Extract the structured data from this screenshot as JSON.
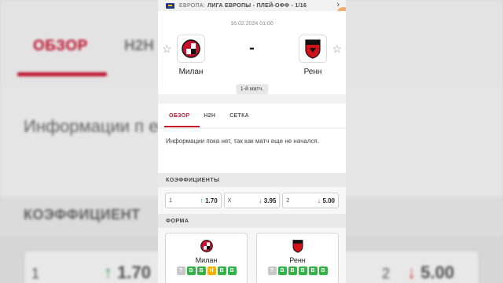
{
  "background": {
    "tab_overview": "ОБЗОР",
    "tab_h2h": "H2H",
    "info_text": "Информации п   еще не начался.",
    "section_odds": "КОЭФФИЦИЕНТ",
    "odd1_label": "1",
    "odd1_value": "1.70",
    "odd2_label": "2",
    "odd2_value": "5.00"
  },
  "header": {
    "region": "ЕВРОПА:",
    "competition": "ЛИГА ЕВРОПЫ - ПЛЕЙ-ОФФ - 1/16"
  },
  "match": {
    "date": "16.02.2024 01:00",
    "score": "-",
    "home": "Милан",
    "away": "Ренн",
    "leg": "1-й матч."
  },
  "tabs": [
    "ОБЗОР",
    "H2H",
    "СЕТКА"
  ],
  "info": "Информации пока нет, так как матч еще не начался.",
  "odds": {
    "title": "КОЭФФИЦИЕНТЫ",
    "items": [
      {
        "label": "1",
        "value": "1.70",
        "trend": "up"
      },
      {
        "label": "X",
        "value": "3.95",
        "trend": "down"
      },
      {
        "label": "2",
        "value": "5.00",
        "trend": "down"
      }
    ]
  },
  "form": {
    "title": "ФОРМА",
    "home": {
      "name": "Милан",
      "results": [
        "?",
        "В",
        "В",
        "Н",
        "В",
        "В"
      ]
    },
    "away": {
      "name": "Ренн",
      "results": [
        "?",
        "В",
        "В",
        "В",
        "В",
        "В"
      ]
    }
  },
  "colors": {
    "accent": "#c8102e",
    "win": "#35b24a",
    "draw": "#f2b300"
  }
}
